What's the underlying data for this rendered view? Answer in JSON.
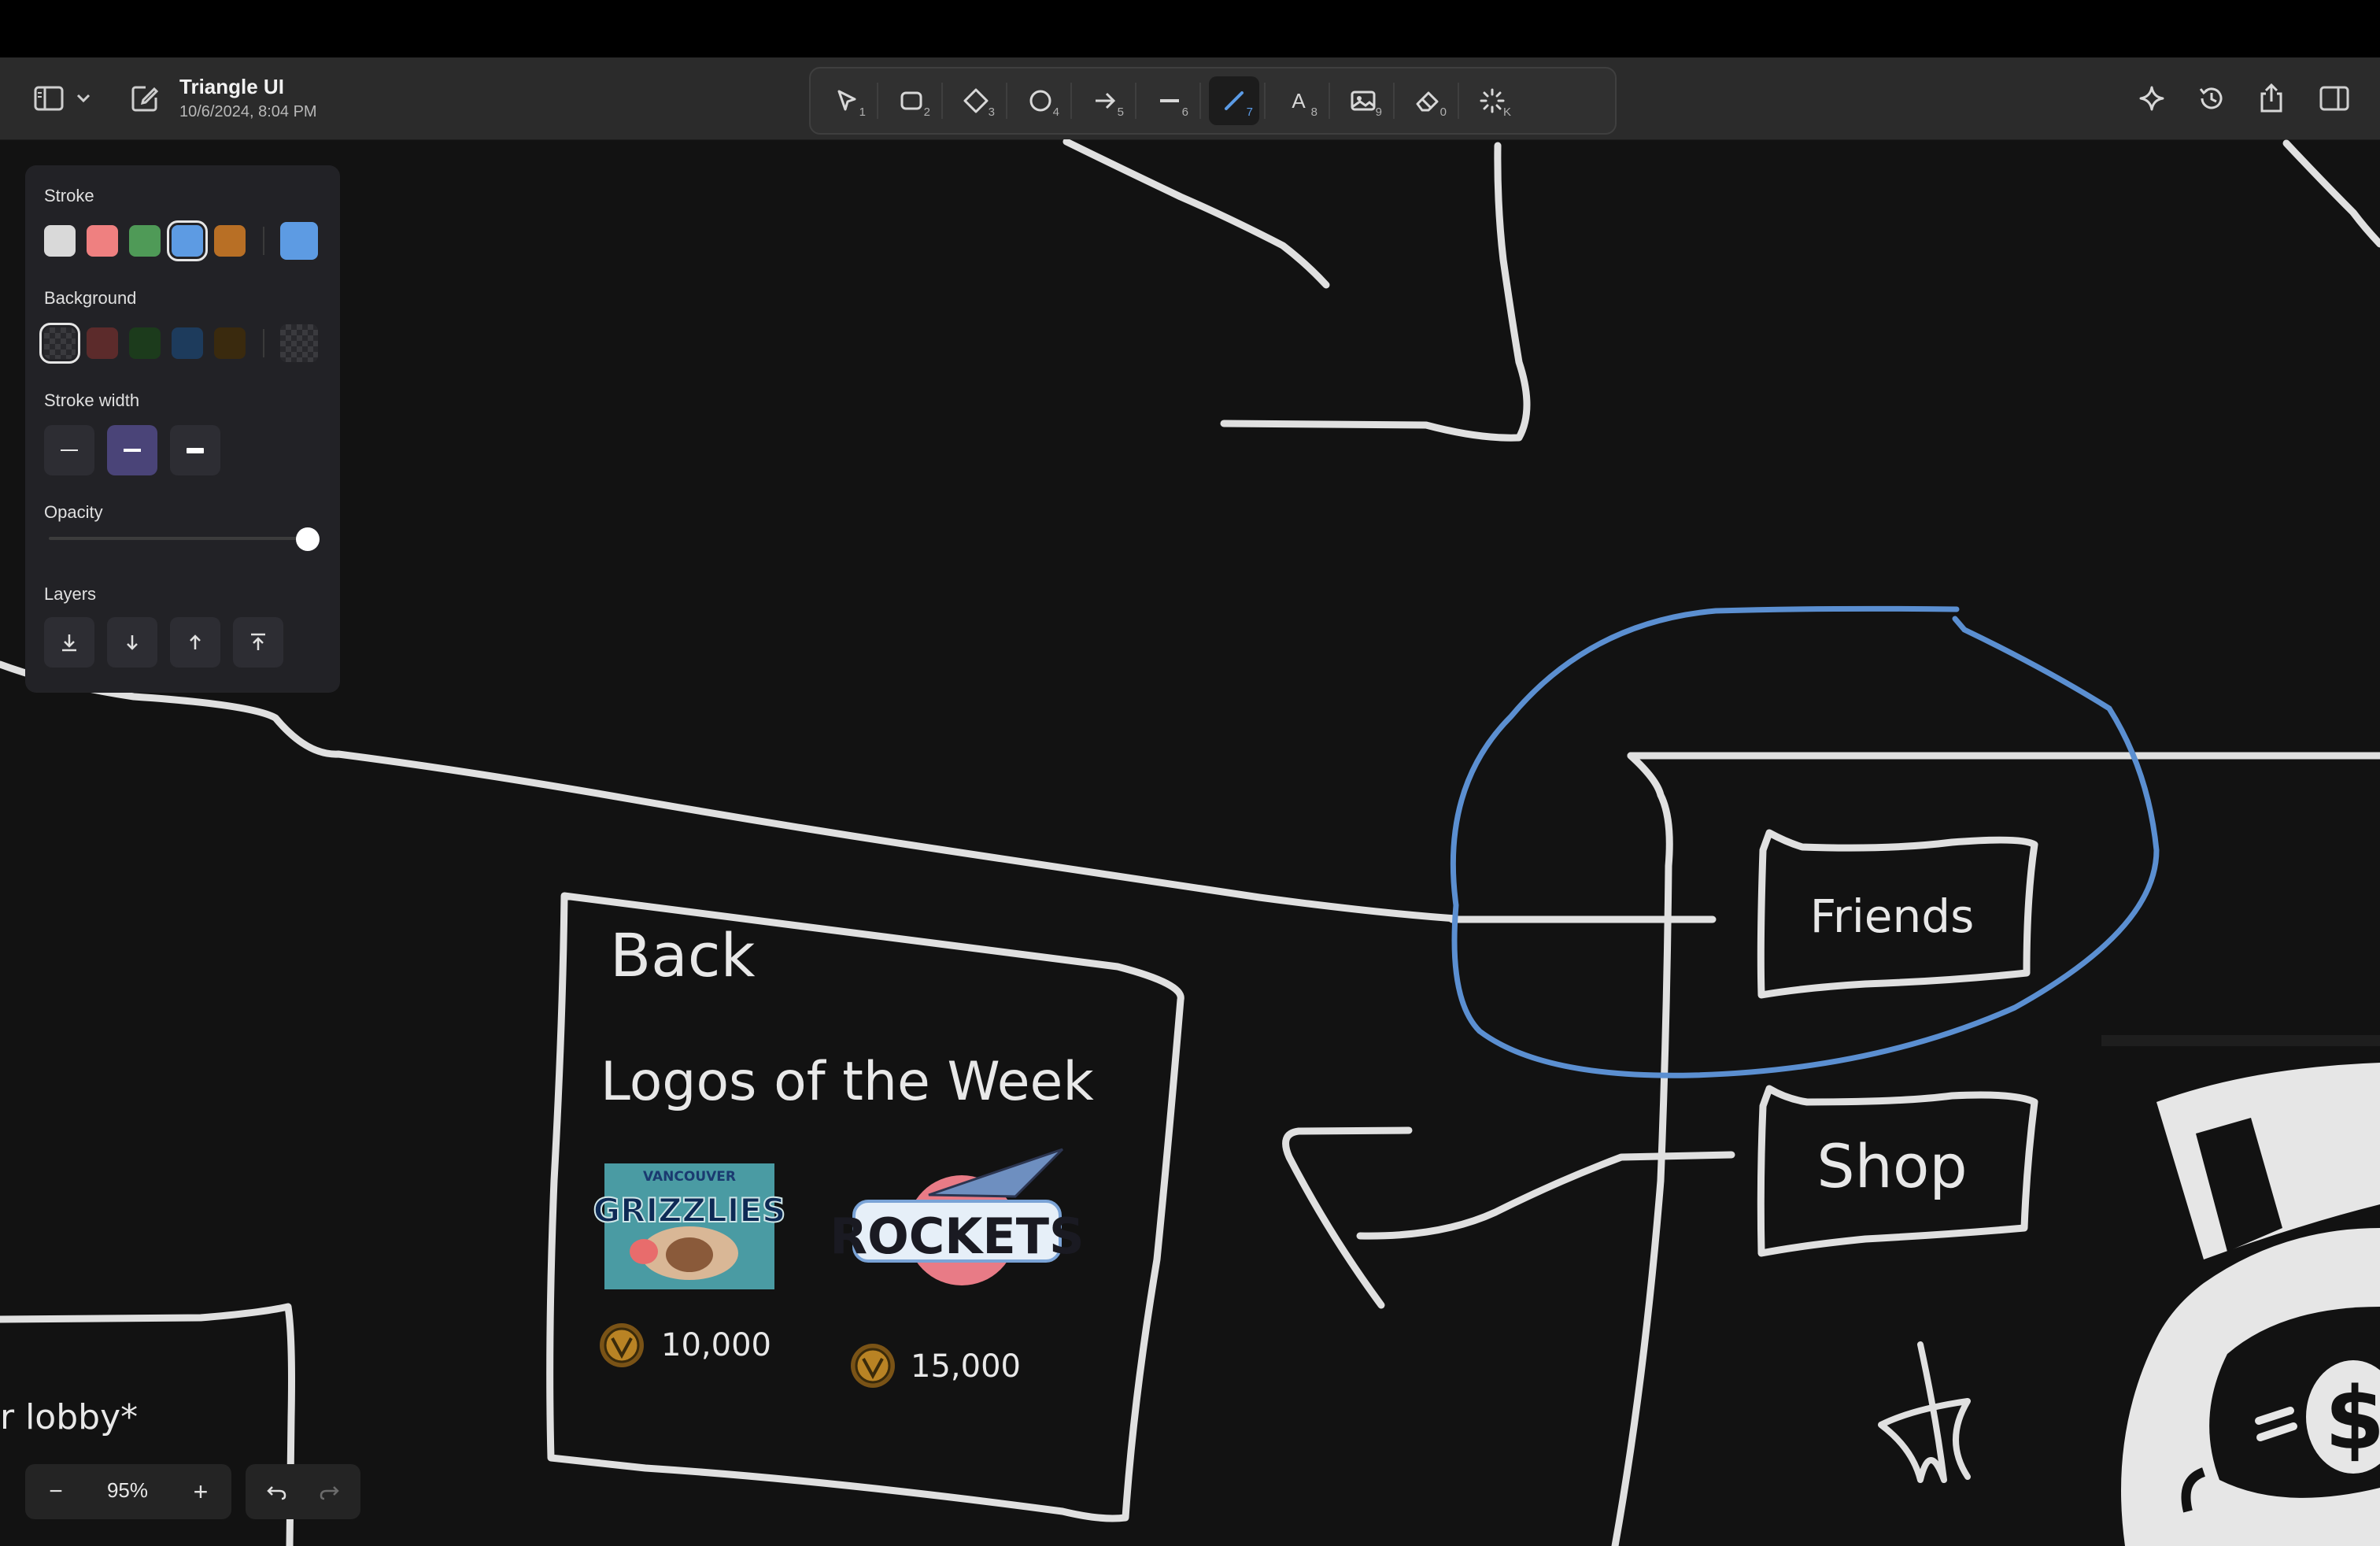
{
  "document": {
    "title": "Triangle UI",
    "date": "10/6/2024, 8:04 PM"
  },
  "toolbar": {
    "left": [
      "sidebar-toggle-icon",
      "chevron-down-icon",
      "new-note-icon"
    ],
    "tools": [
      {
        "name": "select-tool",
        "icon": "cursor-icon",
        "shortcut": "1"
      },
      {
        "name": "rectangle-tool",
        "icon": "rectangle-icon",
        "shortcut": "2"
      },
      {
        "name": "diamond-tool",
        "icon": "diamond-icon",
        "shortcut": "3"
      },
      {
        "name": "ellipse-tool",
        "icon": "ellipse-icon",
        "shortcut": "4"
      },
      {
        "name": "arrow-tool",
        "icon": "arrow-icon",
        "shortcut": "5"
      },
      {
        "name": "line-tool",
        "icon": "line-icon",
        "shortcut": "6"
      },
      {
        "name": "pen-tool",
        "icon": "pen-icon",
        "shortcut": "7",
        "active": true
      },
      {
        "name": "text-tool",
        "icon": "text-icon",
        "shortcut": "8",
        "glyph": "A"
      },
      {
        "name": "image-tool",
        "icon": "image-icon",
        "shortcut": "9"
      },
      {
        "name": "eraser-tool",
        "icon": "eraser-icon",
        "shortcut": "0"
      },
      {
        "name": "laser-tool",
        "icon": "laser-icon",
        "shortcut": "K"
      }
    ],
    "right": [
      "sparkle-icon",
      "history-icon",
      "share-icon",
      "right-sidebar-icon"
    ]
  },
  "panel": {
    "stroke_label": "Stroke",
    "background_label": "Background",
    "stroke_width_label": "Stroke width",
    "opacity_label": "Opacity",
    "layers_label": "Layers",
    "stroke_colors": [
      "#d9d9d9",
      "#ef8080",
      "#4f9a57",
      "#5d9be3",
      "#b86f25"
    ],
    "stroke_selected_index": 3,
    "stroke_current": "#5d9be3",
    "background_colors": [
      "transparent",
      "#5c2b2b",
      "#1c3b1c",
      "#1d3b5c",
      "#3a2a0e"
    ],
    "background_selected_index": 0,
    "stroke_width_selected": "medium",
    "opacity": 1.0,
    "layer_actions": [
      "send-to-back-icon",
      "send-backward-icon",
      "bring-forward-icon",
      "bring-to-front-icon"
    ]
  },
  "zoom": {
    "minus": "−",
    "value": "95%",
    "plus": "+"
  },
  "history": [
    "undo-icon",
    "redo-icon"
  ],
  "canvas": {
    "back_label": "Back",
    "card_title": "Logos of the Week",
    "price_1": "10,000",
    "price_2": "15,000",
    "logo_1_text": "GRIZZLIES",
    "logo_1_top": "VANCOUVER",
    "logo_2_text": "ROCKETS",
    "friends_label": "Friends",
    "shop_label": "Shop",
    "lobby_text": "r lobby*",
    "accent_color": "#5b8fd1",
    "stroke_color": "#e0e0e0"
  }
}
